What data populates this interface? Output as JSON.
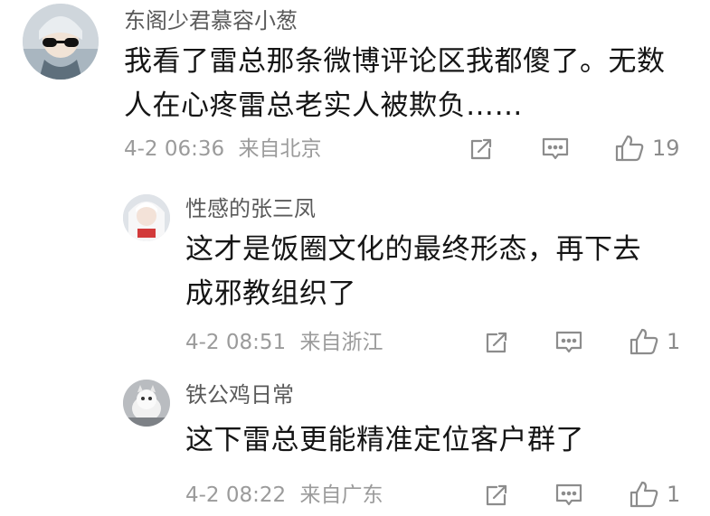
{
  "comments": [
    {
      "author": "东阁少君慕容小葱",
      "content_lines": [
        "我看了雷总那条微博评论区我都傻了。无数",
        "人在心疼雷总老实人被欺负……"
      ],
      "date": "4-2 06:36",
      "location": "来自北京",
      "likes": "19"
    },
    {
      "author": "性感的张三凤",
      "content_lines": [
        "这才是饭圈文化的最终形态，再下去",
        "成邪教组织了"
      ],
      "date": "4-2 08:51",
      "location": "来自浙江",
      "likes": "1"
    },
    {
      "author": "铁公鸡日常",
      "content_lines": [
        "这下雷总更能精准定位客户群了"
      ],
      "date": "4-2 08:22",
      "location": "来自广东",
      "likes": "1"
    }
  ],
  "icons": {
    "share": "share-icon",
    "reply": "comment-icon",
    "like": "thumbs-up-icon"
  }
}
